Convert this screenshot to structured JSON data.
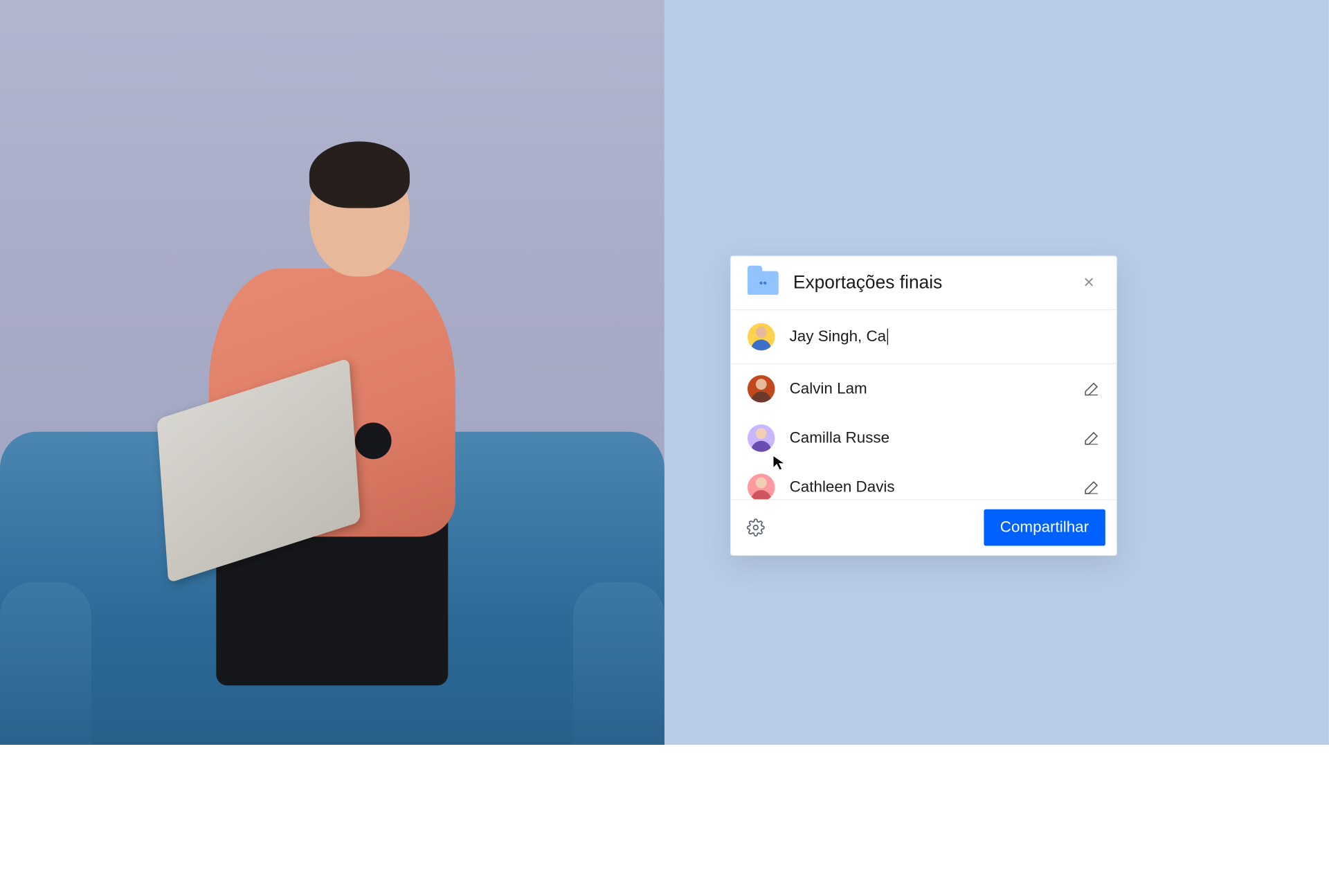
{
  "dialog": {
    "title": "Exportações finais",
    "input_value": "Jay Singh, Ca",
    "suggestions": [
      {
        "name": "Calvin Lam",
        "avatar_bg": "#c2491d",
        "skin": "#e7b899",
        "shirt": "#6b3a2b"
      },
      {
        "name": "Camilla Russe",
        "avatar_bg": "#c8b7ff",
        "skin": "#f0cfb6",
        "shirt": "#6a4db0"
      },
      {
        "name": "Cathleen Davis",
        "avatar_bg": "#ff9aa0",
        "skin": "#f0cfb6",
        "shirt": "#cc5560"
      }
    ],
    "input_avatar": {
      "bg": "#ffd24d",
      "skin": "#e7b899",
      "shirt": "#3b6fc8"
    },
    "share_label": "Compartilhar"
  },
  "icons": {
    "close": "×",
    "folder_people": "••"
  }
}
